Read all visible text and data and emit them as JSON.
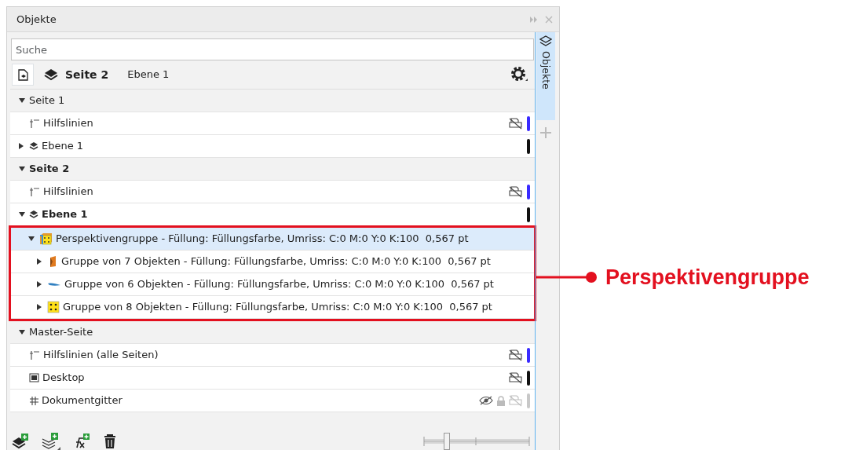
{
  "window": {
    "title": "Objekte"
  },
  "search": {
    "placeholder": "Suche"
  },
  "toolbar": {
    "page": "Seite 2",
    "layer": "Ebene 1"
  },
  "side_tab": {
    "label": "Objekte",
    "selected": true
  },
  "pages": [
    {
      "label": "Seite 1",
      "active": false,
      "expanded": true,
      "children": [
        {
          "kind": "guides",
          "label": "Hilfslinien",
          "active": false,
          "selected": false,
          "print_icon": true,
          "hidden": false,
          "color": "#3a2bff"
        },
        {
          "kind": "layer",
          "label": "Ebene 1",
          "active": false,
          "selected": false,
          "expanded": false,
          "print_icon": false,
          "hidden": false,
          "color": "#111111"
        }
      ]
    },
    {
      "label": "Seite 2",
      "active": true,
      "expanded": true,
      "children": [
        {
          "kind": "guides",
          "label": "Hilfslinien",
          "active": false,
          "selected": false,
          "print_icon": true,
          "hidden": false,
          "color": "#3a2bff"
        },
        {
          "kind": "layer",
          "label": "Ebene 1",
          "active": true,
          "selected": false,
          "expanded": true,
          "print_icon": false,
          "hidden": false,
          "color": "#111111",
          "children": [
            {
              "kind": "perspective",
              "label": "Perspektivengruppe - Füllung: Füllungsfarbe, Umriss: C:0 M:0 Y:0 K:100  0,567 pt",
              "selected": true,
              "expanded": true,
              "highlighted": true,
              "children": [
                {
                  "kind": "wedge",
                  "label": "Gruppe von 7 Objekten - Füllung: Füllungsfarbe, Umriss: C:0 M:0 Y:0 K:100  0,567 pt",
                  "selected": false,
                  "expanded": false
                },
                {
                  "kind": "leaf",
                  "label": "Gruppe von 6 Objekten - Füllung: Füllungsfarbe, Umriss: C:0 M:0 Y:0 K:100  0,567 pt",
                  "selected": false,
                  "expanded": false
                },
                {
                  "kind": "dots",
                  "label": "Gruppe von 8 Objekten - Füllung: Füllungsfarbe, Umriss: C:0 M:0 Y:0 K:100  0,567 pt",
                  "selected": false,
                  "expanded": false
                }
              ]
            }
          ]
        }
      ]
    },
    {
      "label": "Master-Seite",
      "active": false,
      "expanded": true,
      "children": [
        {
          "kind": "guides",
          "label": "Hilfslinien (alle Seiten)",
          "active": false,
          "selected": false,
          "print_icon": true,
          "hidden": false,
          "color": "#3a2bff"
        },
        {
          "kind": "desktop",
          "label": "Desktop",
          "active": false,
          "selected": false,
          "print_icon": true,
          "hidden": false,
          "color": "#111111"
        },
        {
          "kind": "grid",
          "label": "Dokumentgitter",
          "active": false,
          "selected": false,
          "print_icon": true,
          "hidden": true,
          "color": "#c8c8c8"
        }
      ]
    }
  ],
  "zoom_slider": {
    "level": 0.22
  },
  "callout": {
    "label": "Perspektivengruppe"
  }
}
